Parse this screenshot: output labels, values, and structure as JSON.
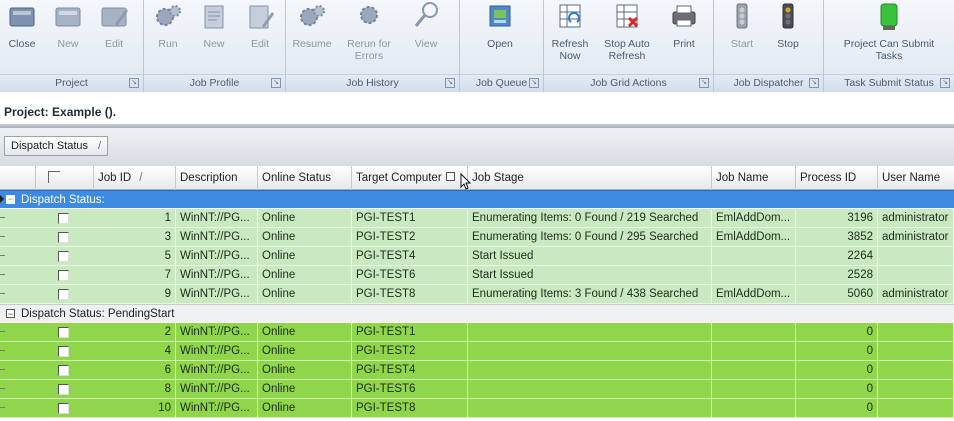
{
  "ribbon": {
    "groups": [
      {
        "label": "Project",
        "buttons": [
          "Close",
          "New",
          "Edit"
        ]
      },
      {
        "label": "Job Profile",
        "buttons": [
          "Run",
          "New",
          "Edit"
        ]
      },
      {
        "label": "Job History",
        "buttons": [
          "Resume",
          "Rerun for Errors",
          "View"
        ]
      },
      {
        "label": "Job Queue",
        "buttons": [
          "Open"
        ]
      },
      {
        "label": "Job Grid Actions",
        "buttons": [
          "Refresh Now",
          "Stop Auto Refresh",
          "Print"
        ]
      },
      {
        "label": "Job Dispatcher",
        "buttons": [
          "Start",
          "Stop"
        ]
      },
      {
        "label": "Task Submit Status",
        "buttons": [
          "Project Can Submit Tasks"
        ]
      }
    ]
  },
  "project": {
    "title": "Project: Example ()."
  },
  "groupby": {
    "label": "Dispatch Status",
    "sort": "/"
  },
  "grid": {
    "columns": [
      "",
      "Job ID",
      "Description",
      "Online Status",
      "Target Computer",
      "Job Stage",
      "Job Name",
      "Process ID",
      "User Name"
    ],
    "sort_marker": "/",
    "groups": [
      {
        "label": "Dispatch Status:",
        "toggle": "−",
        "rows": [
          {
            "job_id": "1",
            "description": "WinNT://PG...",
            "online": "Online",
            "target": "PGI-TEST1",
            "stage": "Enumerating Items: 0 Found / 219 Searched",
            "job_name": "EmlAddDom...",
            "pid": "3196",
            "user": "administrator"
          },
          {
            "job_id": "3",
            "description": "WinNT://PG...",
            "online": "Online",
            "target": "PGI-TEST2",
            "stage": "Enumerating Items: 0 Found / 295 Searched",
            "job_name": "EmlAddDom...",
            "pid": "3852",
            "user": "administrator"
          },
          {
            "job_id": "5",
            "description": "WinNT://PG...",
            "online": "Online",
            "target": "PGI-TEST4",
            "stage": "Start Issued",
            "job_name": "",
            "pid": "2264",
            "user": ""
          },
          {
            "job_id": "7",
            "description": "WinNT://PG...",
            "online": "Online",
            "target": "PGI-TEST6",
            "stage": "Start Issued",
            "job_name": "",
            "pid": "2528",
            "user": ""
          },
          {
            "job_id": "9",
            "description": "WinNT://PG...",
            "online": "Online",
            "target": "PGI-TEST8",
            "stage": "Enumerating Items: 3 Found / 438 Searched",
            "job_name": "EmlAddDom...",
            "pid": "5060",
            "user": "administrator"
          }
        ]
      },
      {
        "label": "Dispatch Status: PendingStart",
        "toggle": "−",
        "rows": [
          {
            "job_id": "2",
            "description": "WinNT://PG...",
            "online": "Online",
            "target": "PGI-TEST1",
            "stage": "",
            "job_name": "",
            "pid": "0",
            "user": ""
          },
          {
            "job_id": "4",
            "description": "WinNT://PG...",
            "online": "Online",
            "target": "PGI-TEST2",
            "stage": "",
            "job_name": "",
            "pid": "0",
            "user": ""
          },
          {
            "job_id": "6",
            "description": "WinNT://PG...",
            "online": "Online",
            "target": "PGI-TEST4",
            "stage": "",
            "job_name": "",
            "pid": "0",
            "user": ""
          },
          {
            "job_id": "8",
            "description": "WinNT://PG...",
            "online": "Online",
            "target": "PGI-TEST6",
            "stage": "",
            "job_name": "",
            "pid": "0",
            "user": ""
          },
          {
            "job_id": "10",
            "description": "WinNT://PG...",
            "online": "Online",
            "target": "PGI-TEST8",
            "stage": "",
            "job_name": "",
            "pid": "0",
            "user": ""
          }
        ]
      }
    ]
  },
  "icons": {
    "close": "close-project-icon",
    "new": "new-project-icon",
    "edit": "edit-project-icon",
    "run": "run-gears-icon",
    "profile_new": "new-profile-icon",
    "profile_edit": "edit-profile-icon",
    "resume": "resume-gears-icon",
    "rerun": "rerun-gears-icon",
    "view": "magnifier-icon",
    "open": "open-queue-icon",
    "refresh": "refresh-grid-icon",
    "stop_refresh": "stop-refresh-grid-icon",
    "print": "printer-icon",
    "start": "traffic-light-start-icon",
    "stop": "traffic-light-stop-icon",
    "submit": "green-light-icon"
  },
  "colors": {
    "group_header": "#3d8be0",
    "row_active": "#c9eac0",
    "row_pending": "#8fd64b"
  }
}
